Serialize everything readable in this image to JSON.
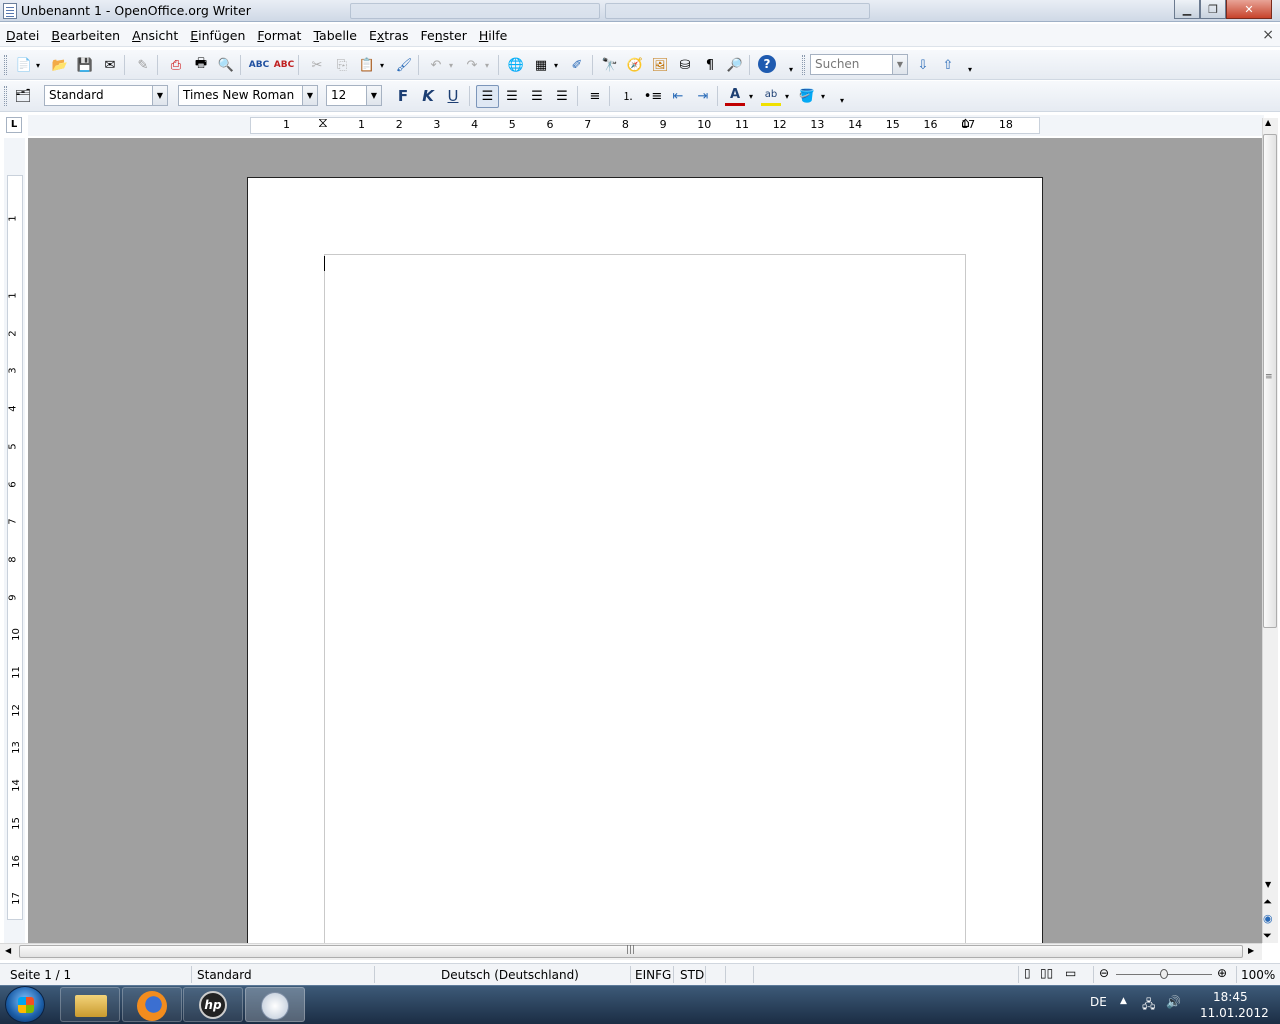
{
  "window": {
    "title": "Unbenannt 1 - OpenOffice.org Writer",
    "minimize_icon": "minimize-icon",
    "maximize_icon": "restore-icon",
    "close_icon": "close-icon"
  },
  "menu": {
    "items": [
      {
        "label": "Datei",
        "key": "D"
      },
      {
        "label": "Bearbeiten",
        "key": "B"
      },
      {
        "label": "Ansicht",
        "key": "A"
      },
      {
        "label": "Einfügen",
        "key": "E"
      },
      {
        "label": "Format",
        "key": "F"
      },
      {
        "label": "Tabelle",
        "key": "T"
      },
      {
        "label": "Extras",
        "key": "x"
      },
      {
        "label": "Fenster",
        "key": "n"
      },
      {
        "label": "Hilfe",
        "key": "H"
      }
    ],
    "close_glyph": "×"
  },
  "standard_toolbar": {
    "search_placeholder": "Suchen"
  },
  "format_toolbar": {
    "paragraph_style": "Standard",
    "font_name": "Times New Roman",
    "font_size": "12",
    "bold_label": "F",
    "italic_label": "K",
    "underline_label": "U"
  },
  "ruler": {
    "h_numbers": [
      "1",
      "1",
      "2",
      "3",
      "4",
      "5",
      "6",
      "7",
      "8",
      "9",
      "10",
      "11",
      "12",
      "13",
      "14",
      "15",
      "16",
      "17",
      "18"
    ],
    "v_numbers": [
      "1",
      "1",
      "2",
      "3",
      "4",
      "5",
      "6",
      "7",
      "8",
      "9",
      "10",
      "11",
      "12",
      "13",
      "14",
      "15",
      "16",
      "17"
    ]
  },
  "statusbar": {
    "page": "Seite 1 / 1",
    "style": "Standard",
    "language": "Deutsch (Deutschland)",
    "insert_mode": "EINFG",
    "selection_mode": "STD",
    "zoom": "100%",
    "zoom_level": 1.0
  },
  "taskbar": {
    "language": "DE",
    "time": "18:45",
    "date": "11.01.2012",
    "apps": [
      "explorer-icon",
      "firefox-icon",
      "hp-icon",
      "openoffice-writer-icon"
    ]
  },
  "colors": {
    "doc_background": "#a0a0a0",
    "page": "#ffffff",
    "taskbar": "#1b2d44"
  }
}
